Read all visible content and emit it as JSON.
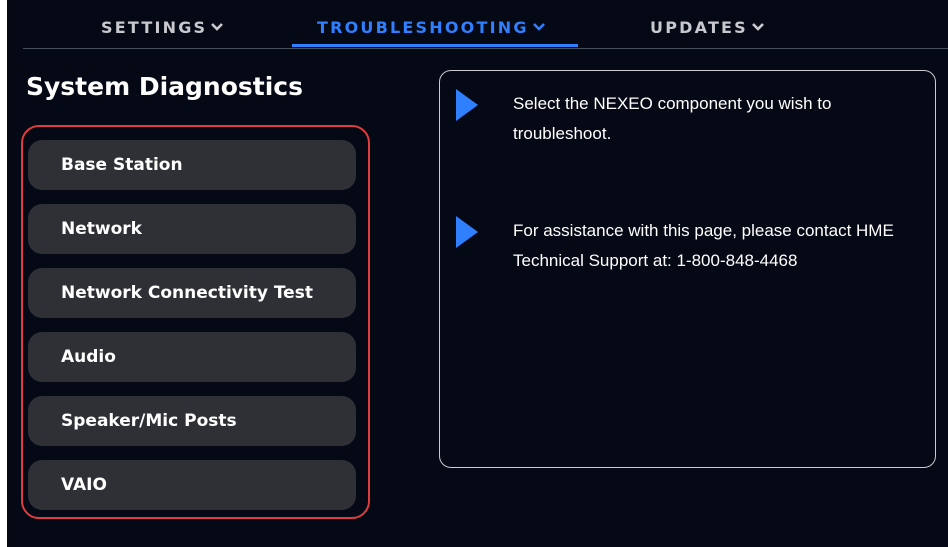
{
  "nav": {
    "items": [
      {
        "label": "SETTINGS",
        "icon": "chevron-down-icon",
        "active": false
      },
      {
        "label": "TROUBLESHOOTING",
        "icon": "chevron-down-icon",
        "active": true
      },
      {
        "label": "UPDATES",
        "icon": "chevron-down-icon",
        "active": false
      }
    ]
  },
  "diagnostics": {
    "title": "System Diagnostics",
    "items": [
      {
        "label": "Base Station"
      },
      {
        "label": "Network"
      },
      {
        "label": "Network Connectivity Test"
      },
      {
        "label": "Audio"
      },
      {
        "label": "Speaker/Mic Posts"
      },
      {
        "label": "VAIO"
      }
    ]
  },
  "info": {
    "icon": "play-arrow-icon",
    "lines": [
      {
        "text": "Select the NEXEO component you wish to troubleshoot."
      },
      {
        "text": "For assistance with this page, please contact HME Technical Support at: 1-800-848-4468"
      }
    ]
  },
  "colors": {
    "background": "#050815",
    "accent": "#2f7fff",
    "button": "#2e3035",
    "highlight": "#e03c3c",
    "nav_text": "#c8c9ce"
  }
}
